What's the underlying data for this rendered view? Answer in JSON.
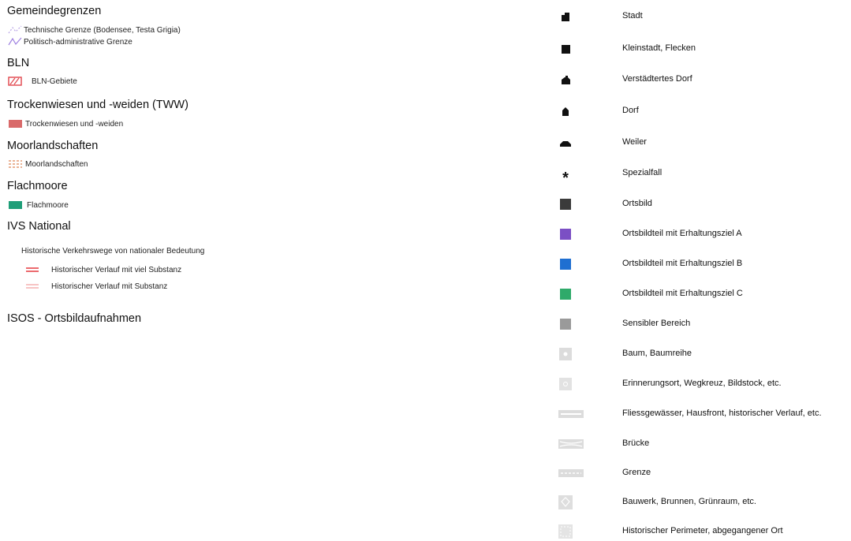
{
  "sections": {
    "gemeindegrenzen": {
      "title": "Gemeindegrenzen",
      "items": [
        {
          "label": "Technische Grenze (Bodensee, Testa Grigia)",
          "icon": "dotted-boundary-icon"
        },
        {
          "label": "Politisch-administrative Grenze",
          "icon": "boundary-line-icon"
        }
      ]
    },
    "bln": {
      "title": "BLN",
      "items": [
        {
          "label": "BLN-Gebiete",
          "icon": "hatched-area-icon",
          "color": "#e0454b"
        }
      ]
    },
    "tww": {
      "title": "Trockenwiesen und -weiden (TWW)",
      "items": [
        {
          "label": "Trockenwiesen und -weiden",
          "icon": "filled-area-icon",
          "color": "#d96a6a"
        }
      ]
    },
    "moor": {
      "title": "Moorlandschaften",
      "items": [
        {
          "label": "Moorlandschaften",
          "icon": "dashed-area-icon",
          "color": "#e49a72"
        }
      ]
    },
    "flach": {
      "title": "Flachmoore",
      "items": [
        {
          "label": "Flachmoore",
          "icon": "filled-area-icon",
          "color": "#1f9e78"
        }
      ]
    },
    "ivs": {
      "title": "IVS National",
      "subtitle": "Historische Verkehrswege von nationaler Bedeutung",
      "items": [
        {
          "label": "Historischer Verlauf mit viel Substanz",
          "icon": "double-line-icon",
          "color": "#e5393f"
        },
        {
          "label": "Historischer Verlauf mit Substanz",
          "icon": "double-line-thin-icon",
          "color": "#ef8a8a"
        }
      ]
    },
    "isos": {
      "title": "ISOS - Ortsbildaufnahmen"
    }
  },
  "isos_legend": [
    {
      "label": "Stadt",
      "icon": "stadt-icon"
    },
    {
      "label": "Kleinstadt, Flecken",
      "icon": "kleinstadt-icon"
    },
    {
      "label": "Verstädtertes Dorf",
      "icon": "verstaedtertes-dorf-icon"
    },
    {
      "label": "Dorf",
      "icon": "dorf-icon"
    },
    {
      "label": "Weiler",
      "icon": "weiler-icon"
    },
    {
      "label": "Spezialfall",
      "icon": "asterisk-icon"
    },
    {
      "label": "Ortsbild",
      "icon": "square-icon",
      "color": "#3b3b3b"
    },
    {
      "label": "Ortsbildteil mit Erhaltungsziel A",
      "icon": "square-icon",
      "color": "#7b4fc4"
    },
    {
      "label": "Ortsbildteil mit Erhaltungsziel B",
      "icon": "square-icon",
      "color": "#1f6fd1"
    },
    {
      "label": "Ortsbildteil mit Erhaltungsziel C",
      "icon": "square-icon",
      "color": "#2faa6a"
    },
    {
      "label": "Sensibler Bereich",
      "icon": "square-icon",
      "color": "#9a9a9a"
    },
    {
      "label": "Baum, Baumreihe",
      "icon": "tree-icon"
    },
    {
      "label": "Erinnerungsort, Wegkreuz, Bildstock, etc.",
      "icon": "memorial-icon"
    },
    {
      "label": "Fliessgewässer, Hausfront, historischer Verlauf, etc.",
      "icon": "line-icon"
    },
    {
      "label": "Brücke",
      "icon": "bridge-icon"
    },
    {
      "label": "Grenze",
      "icon": "dashed-line-icon"
    },
    {
      "label": "Bauwerk, Brunnen, Grünraum, etc.",
      "icon": "building-icon"
    },
    {
      "label": "Historischer Perimeter, abgegangener Ort",
      "icon": "perimeter-icon"
    }
  ]
}
